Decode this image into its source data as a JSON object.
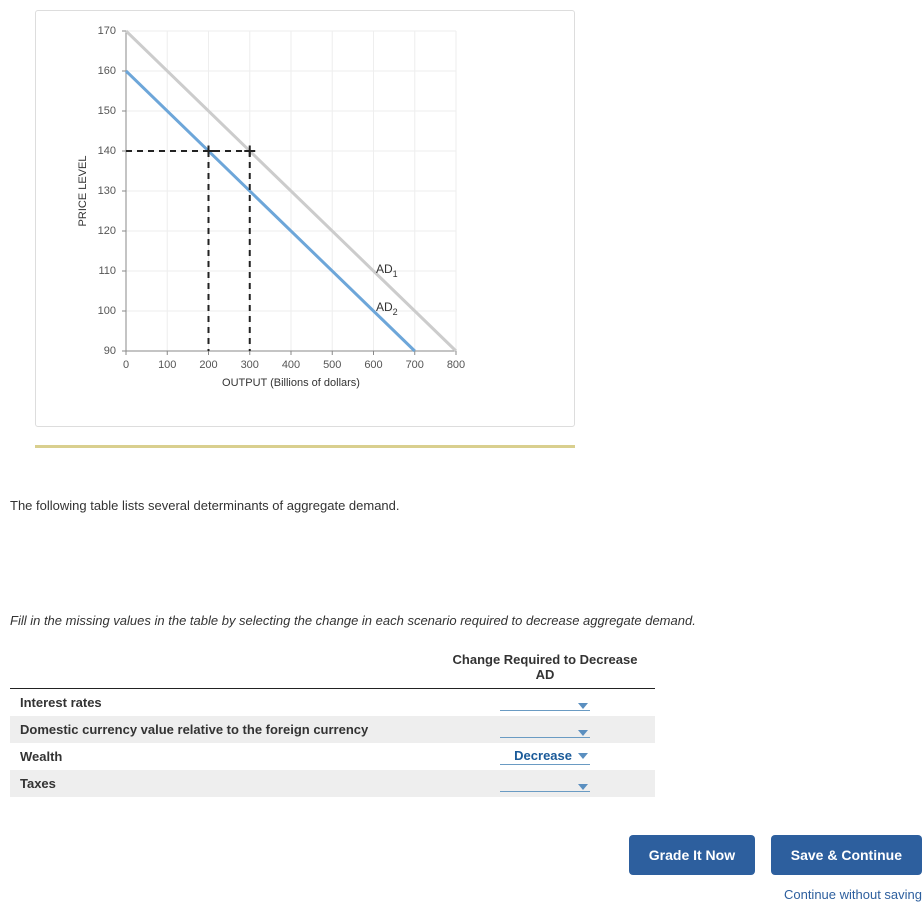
{
  "chart_data": {
    "type": "line",
    "title": "",
    "xlabel": "OUTPUT (Billions of dollars)",
    "ylabel": "PRICE LEVEL",
    "xlim": [
      0,
      800
    ],
    "ylim": [
      90,
      170
    ],
    "x_ticks": [
      0,
      100,
      200,
      300,
      400,
      500,
      600,
      700,
      800
    ],
    "y_ticks": [
      90,
      100,
      110,
      120,
      130,
      140,
      150,
      160,
      170
    ],
    "series": [
      {
        "name": "AD1",
        "x": [
          0,
          800
        ],
        "y": [
          170,
          90
        ],
        "color": "#cccccc"
      },
      {
        "name": "AD2",
        "x": [
          0,
          700
        ],
        "y": [
          160,
          90
        ],
        "color": "#6da6d9"
      }
    ],
    "reference_lines": [
      {
        "axis": "y",
        "value": 140,
        "from_x": 0,
        "to_x": 300
      },
      {
        "axis": "x",
        "value": 200,
        "from_y": 90,
        "to_y": 140
      },
      {
        "axis": "x",
        "value": 300,
        "from_y": 90,
        "to_y": 140
      }
    ]
  },
  "text": {
    "intro": "The following table lists several determinants of aggregate demand.",
    "instruction": "Fill in the missing values in the table by selecting the change in each scenario required to decrease aggregate demand."
  },
  "table": {
    "header_col1": "",
    "header_col2": "Change Required to Decrease AD",
    "rows": [
      {
        "label": "Interest rates",
        "value": ""
      },
      {
        "label": "Domestic currency value relative to the foreign currency",
        "value": ""
      },
      {
        "label": "Wealth",
        "value": "Decrease"
      },
      {
        "label": "Taxes",
        "value": ""
      }
    ]
  },
  "buttons": {
    "grade": "Grade It Now",
    "save": "Save & Continue",
    "continue_link": "Continue without saving"
  }
}
